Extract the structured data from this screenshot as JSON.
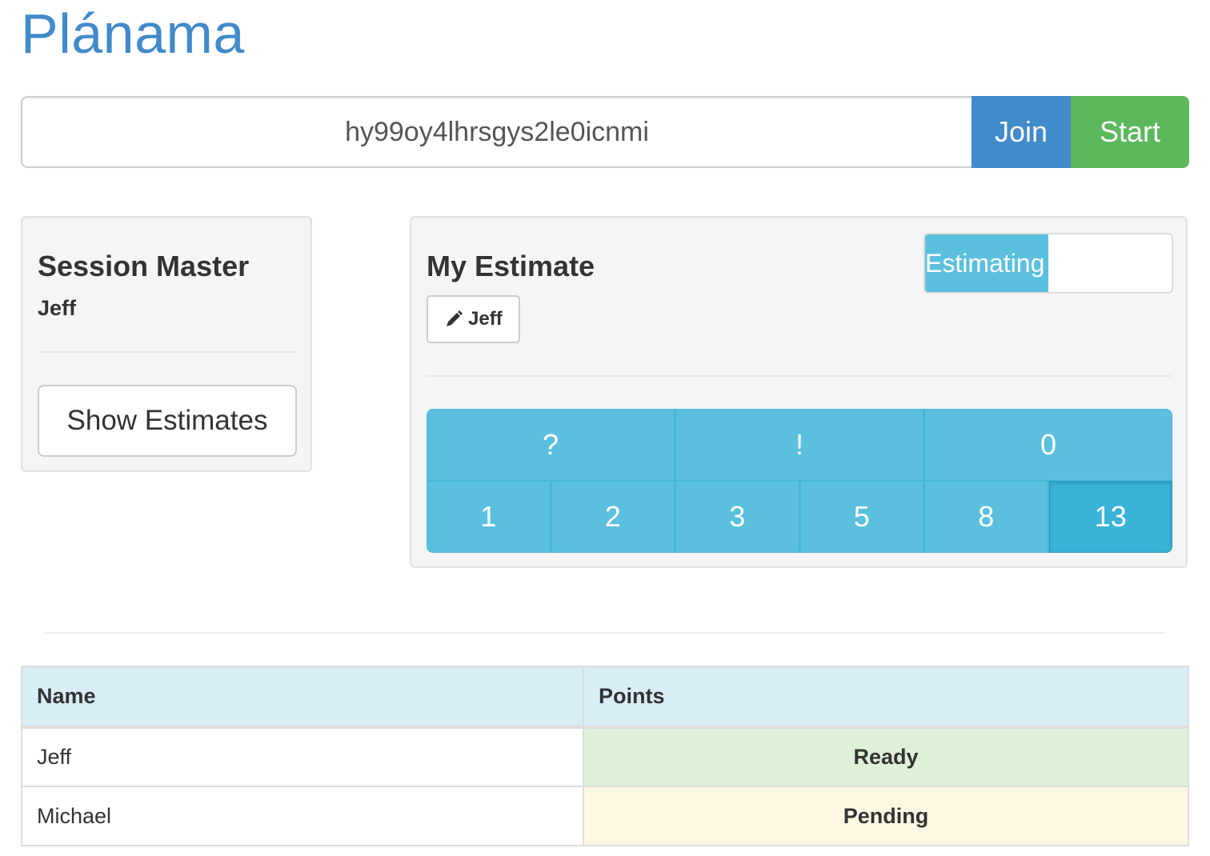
{
  "app": {
    "title": "Plánama"
  },
  "session": {
    "id_value": "hy99oy4lhrsgys2le0icnmi",
    "join_label": "Join",
    "start_label": "Start"
  },
  "master": {
    "heading": "Session Master",
    "name": "Jeff",
    "show_estimates_label": "Show Estimates"
  },
  "estimate": {
    "heading": "My Estimate",
    "player_name": "Jeff",
    "edit_icon": "pencil-icon",
    "status_label": "Estimating",
    "status_progress_percent": 50,
    "cards_top": [
      "?",
      "!",
      "0"
    ],
    "cards_bottom": [
      "1",
      "2",
      "3",
      "5",
      "8",
      "13"
    ],
    "selected_card": "13"
  },
  "table": {
    "headers": [
      "Name",
      "Points"
    ],
    "rows": [
      {
        "name": "Jeff",
        "points": "Ready",
        "state": "ready"
      },
      {
        "name": "Michael",
        "points": "Pending",
        "state": "pending"
      }
    ]
  },
  "colors": {
    "primary": "#428bca",
    "success": "#5cb85c",
    "info": "#5bc0de",
    "info_active": "#39b3d7",
    "ready_bg": "#dff0d8",
    "pending_bg": "#fcf8e3",
    "table_header_bg": "#d9edf7"
  }
}
